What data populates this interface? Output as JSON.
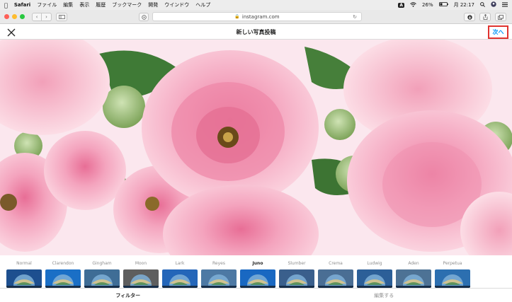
{
  "menubar": {
    "apple_icon": "apple-icon",
    "app_name": "Safari",
    "items": [
      "ファイル",
      "編集",
      "表示",
      "履歴",
      "ブックマーク",
      "開発",
      "ウインドウ",
      "ヘルプ"
    ],
    "input_badge": "A",
    "battery": "26%",
    "clock": "月 22:17"
  },
  "browser": {
    "url": "instagram.com",
    "lock_icon": "lock-icon"
  },
  "post_editor": {
    "title": "新しい写真投稿",
    "next_label": "次へ",
    "highlight_color": "#e0332f",
    "link_color": "#0095f6",
    "filters": [
      {
        "name": "Normal",
        "tint": "#1d4f8f"
      },
      {
        "name": "Clarendon",
        "tint": "#1a6fc6"
      },
      {
        "name": "Gingham",
        "tint": "#3f6d96"
      },
      {
        "name": "Moon",
        "tint": "#5e5e5e"
      },
      {
        "name": "Lark",
        "tint": "#2466b9"
      },
      {
        "name": "Reyes",
        "tint": "#4d79a4"
      },
      {
        "name": "Juno",
        "tint": "#1968c2"
      },
      {
        "name": "Slumber",
        "tint": "#3a5f8c"
      },
      {
        "name": "Crema",
        "tint": "#4a6e94"
      },
      {
        "name": "Ludwig",
        "tint": "#2c5f98"
      },
      {
        "name": "Aden",
        "tint": "#4d7295"
      },
      {
        "name": "Perpetua",
        "tint": "#2c6fb0"
      }
    ],
    "selected_filter": "Juno",
    "tabs": [
      {
        "label": "フィルター",
        "active": true
      },
      {
        "label": "編集する",
        "active": false
      }
    ]
  }
}
